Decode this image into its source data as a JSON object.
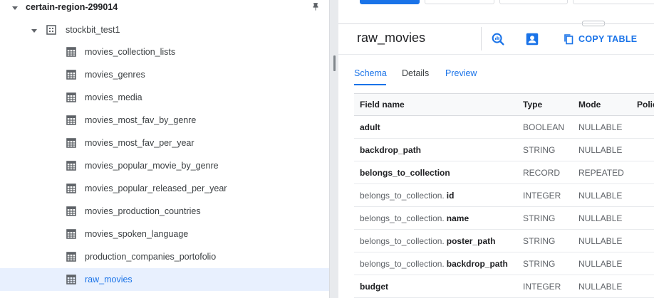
{
  "explorer": {
    "project": "certain-region-299014",
    "dataset": "stockbit_test1",
    "tables": [
      "movies_collection_lists",
      "movies_genres",
      "movies_media",
      "movies_most_fav_by_genre",
      "movies_most_fav_per_year",
      "movies_popular_movie_by_genre",
      "movies_popular_released_per_year",
      "movies_production_countries",
      "movies_spoken_language",
      "production_companies_portofolio",
      "raw_movies"
    ],
    "selected_table": "raw_movies"
  },
  "details": {
    "title": "raw_movies",
    "copy_table_label": "COPY TABLE",
    "tabs": [
      {
        "label": "Schema",
        "active": true
      },
      {
        "label": "Details",
        "active": false
      },
      {
        "label": "Preview",
        "active": false
      }
    ],
    "schema": {
      "headers": {
        "name": "Field name",
        "type": "Type",
        "mode": "Mode",
        "policy": "Polic"
      },
      "rows": [
        {
          "prefix": "",
          "name": "adult",
          "type": "BOOLEAN",
          "mode": "NULLABLE"
        },
        {
          "prefix": "",
          "name": "backdrop_path",
          "type": "STRING",
          "mode": "NULLABLE"
        },
        {
          "prefix": "",
          "name": "belongs_to_collection",
          "type": "RECORD",
          "mode": "REPEATED"
        },
        {
          "prefix": "belongs_to_collection.",
          "name": "id",
          "type": "INTEGER",
          "mode": "NULLABLE"
        },
        {
          "prefix": "belongs_to_collection.",
          "name": "name",
          "type": "STRING",
          "mode": "NULLABLE"
        },
        {
          "prefix": "belongs_to_collection.",
          "name": "poster_path",
          "type": "STRING",
          "mode": "NULLABLE"
        },
        {
          "prefix": "belongs_to_collection.",
          "name": "backdrop_path",
          "type": "STRING",
          "mode": "NULLABLE"
        },
        {
          "prefix": "",
          "name": "budget",
          "type": "INTEGER",
          "mode": "NULLABLE"
        }
      ]
    }
  },
  "colors": {
    "accent": "#1a73e8",
    "selected_bg": "#e8f0fe",
    "muted_text": "#5f6368"
  },
  "icons": {
    "project_caret": "caret-down-icon",
    "dataset": "dataset-icon",
    "table": "table-icon",
    "pin": "pin-icon",
    "query": "query-table-icon",
    "share": "share-icon",
    "copy": "copy-icon"
  }
}
